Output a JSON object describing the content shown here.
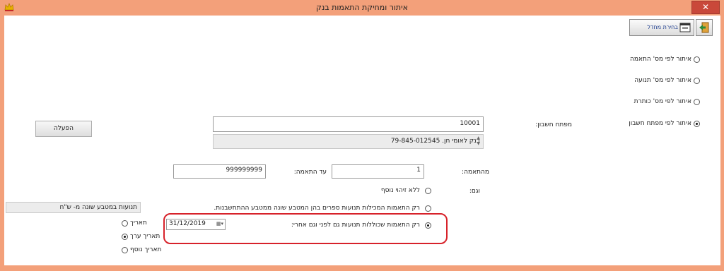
{
  "window": {
    "title": "איתור ומחיקת התאמות בנק",
    "close_glyph": "✕"
  },
  "toolbar": {
    "menu_label": "בחירת מחדל"
  },
  "search_options": [
    {
      "label": "איתור לפי מס' התאמה",
      "selected": false
    },
    {
      "label": "איתור לפי מס' תנועה",
      "selected": false
    },
    {
      "label": "איתור לפי מס' כותרת",
      "selected": false
    },
    {
      "label": "איתור לפי מפתח חשבון",
      "selected": true
    }
  ],
  "account": {
    "label": "מפתח חשבון:",
    "value": "10001",
    "description": "בנק לאומי  חן. 79-845-012545"
  },
  "run_button": {
    "label": "הפעלה"
  },
  "range": {
    "from_label": "מהתאמה:",
    "from_value": "1",
    "to_label": "עד התאמה:",
    "to_value": "999999999"
  },
  "also": {
    "label": "וגם:",
    "options": [
      {
        "label": "ללא זיהוי נוסף",
        "selected": false
      },
      {
        "label": "רק התאמות המכילות תנועות ספרים בהן המטבע שונה ממטבע ההתחשבנות.",
        "selected": false
      },
      {
        "label": "רק התאמות שכוללות תנועות גם לפני וגם אחרי:",
        "selected": true
      }
    ]
  },
  "currency_note": "תנועות במטבע שונה מ- ש\"ח",
  "date": {
    "value": "31/12/2019"
  },
  "date_type": [
    {
      "label": "תאריך",
      "selected": false
    },
    {
      "label": "תאריך ערך",
      "selected": true
    },
    {
      "label": "תאריך נוסף",
      "selected": false
    }
  ],
  "colors": {
    "frame": "#f3a07a",
    "highlight": "#d7222a"
  }
}
